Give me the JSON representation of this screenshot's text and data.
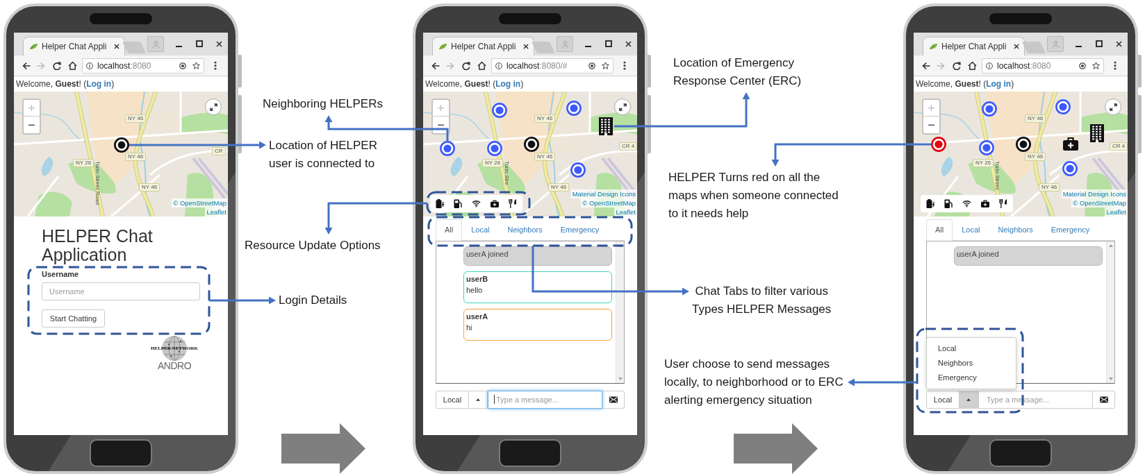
{
  "phones": [
    {
      "browser": {
        "tab_title": "Helper Chat Appli",
        "url_host": "localhost",
        "url_rest": ":8080"
      },
      "welcome": {
        "text": "Welcome, **Guest**! (",
        "link": "Log in",
        "end": ")"
      },
      "map": {
        "zoom_in": {
          "text": "+",
          "disabled": true
        },
        "zoom_out": {
          "text": "−",
          "disabled": false
        },
        "labels": [
          {
            "kind": "shield",
            "text": "NY 46"
          },
          {
            "kind": "shield",
            "text": "NY 46"
          },
          {
            "kind": "shield",
            "text": "NY 26"
          },
          {
            "kind": "shield",
            "text": "NY 46"
          },
          {
            "kind": "shield",
            "text": "CR"
          },
          {
            "kind": "street",
            "text": "Turin Street Road"
          }
        ],
        "markers": [
          {
            "kind": "self"
          }
        ],
        "attribution": [
          "© OpenStreetMap",
          "Leaflet"
        ]
      },
      "page": {
        "kind": "login",
        "title": "HELPER Chat Application",
        "field_label": "Username",
        "placeholder": "Username",
        "button": "Start Chatting",
        "logo_top": "HELPER NETWORK",
        "logo_bottom": "ANDRO"
      }
    },
    {
      "browser": {
        "tab_title": "Helper Chat Appli",
        "url_host": "localhost",
        "url_rest": ":8080/#"
      },
      "welcome": {
        "text": "Welcome, **Guest**! (",
        "link": "Log in",
        "end": ")"
      },
      "map": {
        "zoom_in": {
          "text": "+",
          "disabled": true
        },
        "zoom_out": {
          "text": "−",
          "disabled": false
        },
        "labels": [
          {
            "kind": "shield",
            "text": "NY 46"
          },
          {
            "kind": "shield",
            "text": "NY 46"
          },
          {
            "kind": "shield",
            "text": "NY 26"
          },
          {
            "kind": "shield",
            "text": "NY 46"
          },
          {
            "kind": "shield",
            "text": "CR 4"
          },
          {
            "kind": "street",
            "text": "Turin Stre"
          }
        ],
        "markers": [
          {
            "kind": "neighbor",
            "alert": false
          },
          {
            "kind": "neighbor",
            "alert": false
          },
          {
            "kind": "erc"
          },
          {
            "kind": "neighbor",
            "alert": false
          },
          {
            "kind": "neighbor",
            "alert": false
          },
          {
            "kind": "self"
          },
          {
            "kind": "neighbor",
            "alert": false
          }
        ],
        "resource_toolbar": true,
        "attribution": [
          "Material Design Icons",
          "© OpenStreetMap",
          "Leaflet"
        ]
      },
      "page": {
        "kind": "chat",
        "tabs": [
          {
            "label": "All",
            "selected": true
          },
          {
            "label": "Local",
            "selected": false
          },
          {
            "label": "Neighbors",
            "selected": false
          },
          {
            "label": "Emergency",
            "selected": false
          }
        ],
        "messages": [
          {
            "kind": "system",
            "text": "userA joined"
          },
          {
            "kind": "chat",
            "sender": "userB",
            "text": "hello",
            "color": "#3fd4bd"
          },
          {
            "kind": "chat",
            "sender": "userA",
            "text": "hi",
            "color": "#f5a23a"
          }
        ],
        "channel": "Local",
        "menu_expanded": false,
        "placeholder": "Type a message...",
        "input_focused": true
      }
    },
    {
      "browser": {
        "tab_title": "Helper Chat Appli",
        "url_host": "localhost",
        "url_rest": ":8080"
      },
      "welcome": {
        "text": "Welcome, **Guest**! (",
        "link": "Log in",
        "end": ")"
      },
      "map": {
        "zoom_in": {
          "text": "+",
          "disabled": true
        },
        "zoom_out": {
          "text": "−",
          "disabled": false
        },
        "labels": [
          {
            "kind": "shield",
            "text": "NY 46"
          },
          {
            "kind": "shield",
            "text": "NY 46"
          },
          {
            "kind": "shield",
            "text": "NY 26"
          },
          {
            "kind": "shield",
            "text": "NY 46"
          },
          {
            "kind": "shield",
            "text": "CR 4"
          },
          {
            "kind": "street",
            "text": "Turin Street"
          }
        ],
        "markers": [
          {
            "kind": "neighbor",
            "alert": false
          },
          {
            "kind": "neighbor",
            "alert": false
          },
          {
            "kind": "erc"
          },
          {
            "kind": "neighbor",
            "alert": true
          },
          {
            "kind": "neighbor",
            "alert": false
          },
          {
            "kind": "self"
          },
          {
            "kind": "medical"
          },
          {
            "kind": "neighbor",
            "alert": false
          }
        ],
        "resource_toolbar": true,
        "attribution": [
          "Material Design Icons",
          "© OpenStreetMap",
          "Leaflet"
        ]
      },
      "page": {
        "kind": "chat",
        "tabs": [
          {
            "label": "All",
            "selected": true
          },
          {
            "label": "Local",
            "selected": false
          },
          {
            "label": "Neighbors",
            "selected": false
          },
          {
            "label": "Emergency",
            "selected": false
          }
        ],
        "messages": [
          {
            "kind": "system",
            "text": "userA joined"
          }
        ],
        "channel": "Local",
        "menu_expanded": true,
        "menu_items": [
          "Local",
          "Neighbors",
          "Emergency"
        ],
        "placeholder": "Type a message...",
        "input_focused": false
      }
    }
  ],
  "annotations": [
    {
      "text": "Neighboring HELPERs"
    },
    {
      "text": "Location of HELPER\nuser is connected to"
    },
    {
      "text": "Resource Update Options"
    },
    {
      "text": "Login Details"
    },
    {
      "text": "Location of Emergency\nResponse Center (ERC)"
    },
    {
      "text": "HELPER Turns red on all the\nmaps when someone connected\nto it needs help"
    },
    {
      "text": "Chat Tabs to filter various\nTypes HELPER Messages"
    },
    {
      "text": "User choose to send messages\nlocally, to neighborhood or to ERC\nalerting emergency situation"
    }
  ]
}
